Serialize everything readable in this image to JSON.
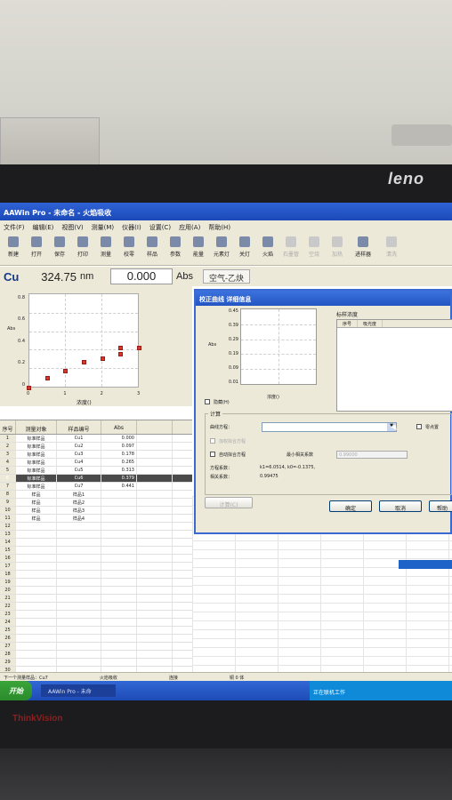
{
  "brand": {
    "top": "leno",
    "bottom": "ThinkVision"
  },
  "window": {
    "title": "AAWin Pro - 未命名 - 火焰吸收"
  },
  "menu": [
    "文件(F)",
    "编辑(E)",
    "视图(V)",
    "测量(M)",
    "仪器(I)",
    "设置(C)",
    "应用(A)",
    "帮助(H)"
  ],
  "toolbar": [
    "新建",
    "打开",
    "保存",
    "打印",
    "测量",
    "校零",
    "样品",
    "参数",
    "能量",
    "元素灯",
    "关灯",
    "火焰",
    "石墨管",
    "空烧",
    "加热",
    "进样器",
    "清洗"
  ],
  "toolbar_disabled": [
    false,
    false,
    false,
    false,
    false,
    false,
    false,
    false,
    false,
    false,
    false,
    false,
    true,
    true,
    true,
    false,
    true
  ],
  "info": {
    "element": "Cu",
    "wavelength": "324.75",
    "wavelength_unit": "nm",
    "abs_value": "0.000",
    "abs_unit": "Abs",
    "gas": "空气-乙炔"
  },
  "chart_data": {
    "type": "scatter",
    "title": "",
    "ylabel": "Abs",
    "xlabel": "浓度()",
    "x_ticks": [
      "0",
      "1",
      "2",
      "3"
    ],
    "y_ticks": [
      "0.8",
      "0.6",
      "0.4",
      "0.2",
      "0"
    ],
    "xlim": [
      0,
      3
    ],
    "ylim": [
      0,
      1
    ],
    "series": [
      {
        "x": [
          0,
          0.5,
          1,
          1.5,
          2,
          2.5,
          2.5,
          3
        ],
        "y": [
          0.0,
          0.1,
          0.18,
          0.27,
          0.31,
          0.36,
          0.42,
          0.42
        ]
      }
    ],
    "accent": "#d23a2e"
  },
  "grid": {
    "headers": [
      "序号",
      "测量对象",
      "样品编号",
      "Abs"
    ],
    "rows": [
      {
        "num": "1",
        "obj": "标准样品",
        "id": "Cu1",
        "abs": "0.000"
      },
      {
        "num": "2",
        "obj": "标准样品",
        "id": "Cu2",
        "abs": "0.097"
      },
      {
        "num": "3",
        "obj": "标准样品",
        "id": "Cu3",
        "abs": "0.178"
      },
      {
        "num": "4",
        "obj": "标准样品",
        "id": "Cu4",
        "abs": "0.265"
      },
      {
        "num": "5",
        "obj": "标准样品",
        "id": "Cu5",
        "abs": "0.313"
      },
      {
        "num": "6",
        "obj": "标准样品",
        "id": "Cu6",
        "abs": "0.379"
      },
      {
        "num": "7",
        "obj": "标准样品",
        "id": "Cu7",
        "abs": "0.441"
      },
      {
        "num": "8",
        "obj": "样品",
        "id": "样品1",
        "abs": ""
      },
      {
        "num": "9",
        "obj": "样品",
        "id": "样品2",
        "abs": ""
      },
      {
        "num": "10",
        "obj": "样品",
        "id": "样品3",
        "abs": ""
      },
      {
        "num": "11",
        "obj": "样品",
        "id": "样品4",
        "abs": ""
      }
    ],
    "empty_rows": [
      "12",
      "13",
      "14",
      "15",
      "16",
      "17",
      "18",
      "19",
      "20",
      "21",
      "22",
      "23",
      "24",
      "25",
      "26",
      "27",
      "28",
      "29",
      "30"
    ],
    "selected_index": 5
  },
  "dialog": {
    "title": "校正曲线 详细信息",
    "y_ticks": [
      "0.45",
      "0.39",
      "0.29",
      "0.19",
      "0.09",
      "0.01"
    ],
    "ylabel": "Abs",
    "xlabel": "浓度()",
    "std_label": "标样浓度",
    "std_headers": [
      "序号",
      "吸光度"
    ],
    "hide_label": "隐藏(H)",
    "calc_label": "计算",
    "curve_label": "曲线方程：",
    "zero_label": "零点置",
    "weighted_label": "加权拟合方程",
    "auto_label": "自动拟合方程",
    "min_r_label": "最小相关系数",
    "min_r_value": "0.99000",
    "coef_label": "方程系数：",
    "coef_value": "k1=6.0514, k0=-0.1375,",
    "r_label": "相关系数：",
    "r_value": "0.99475",
    "btn_calc": "计算(C)",
    "btn_ok": "确定",
    "btn_cancel": "取消",
    "btn_help": "帮助"
  },
  "status": {
    "left": "下一个测量样品：Cu7",
    "mid1": "火焰吸收",
    "mid2": "连接",
    "mid3": "铜 0 体"
  },
  "taskbar": {
    "start": "开始",
    "task": "AAWin Pro - 未命",
    "tray": "正在联机工作"
  }
}
